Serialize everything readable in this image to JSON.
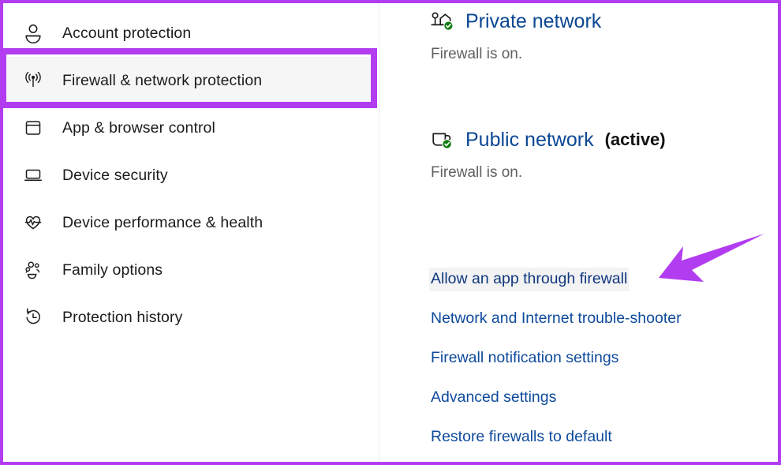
{
  "theme": {
    "annotation_color": "#b23cf0",
    "link_color": "#0e4a9c",
    "heading_color": "#0b4793",
    "status_text_color": "#616161",
    "selected_row_bg": "#f6f6f6",
    "check_badge_color": "#107c10"
  },
  "sidebar": {
    "items": [
      {
        "label": "Account protection",
        "icon": "person-icon",
        "selected": false
      },
      {
        "label": "Firewall & network protection",
        "icon": "wireless-signal-icon",
        "selected": true
      },
      {
        "label": "App & browser control",
        "icon": "window-app-icon",
        "selected": false
      },
      {
        "label": "Device security",
        "icon": "laptop-icon",
        "selected": false
      },
      {
        "label": "Device performance & health",
        "icon": "heart-pulse-icon",
        "selected": false
      },
      {
        "label": "Family options",
        "icon": "people-group-icon",
        "selected": false
      },
      {
        "label": "Protection history",
        "icon": "clock-history-icon",
        "selected": false
      }
    ]
  },
  "content": {
    "networks": [
      {
        "title": "Private network",
        "badge": "",
        "status": "Firewall is on.",
        "icon": "home-network-icon"
      },
      {
        "title": "Public network",
        "badge": "(active)",
        "status": "Firewall is on.",
        "icon": "public-network-icon"
      }
    ],
    "links": [
      {
        "label": "Allow an app through firewall",
        "hovered": true
      },
      {
        "label": "Network and Internet trouble-shooter",
        "hovered": false
      },
      {
        "label": "Firewall notification settings",
        "hovered": false
      },
      {
        "label": "Advanced settings",
        "hovered": false
      },
      {
        "label": "Restore firewalls to default",
        "hovered": false
      }
    ]
  },
  "annotations": {
    "arrow": {
      "name": "pointer-arrow",
      "points_to": "Allow an app through firewall"
    },
    "highlight": {
      "name": "highlight-box",
      "surrounds": "Firewall & network protection"
    }
  }
}
